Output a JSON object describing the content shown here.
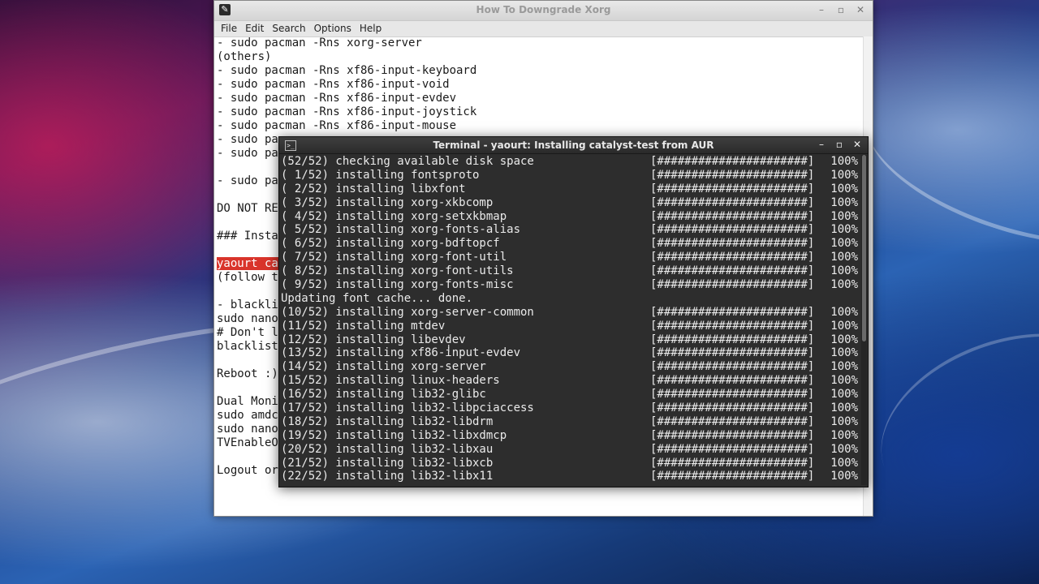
{
  "editor": {
    "title": "How To Downgrade Xorg",
    "menu": [
      "File",
      "Edit",
      "Search",
      "Options",
      "Help"
    ],
    "lines": [
      "- sudo pacman -Rns xorg-server",
      "(others)",
      "- sudo pacman -Rns xf86-input-keyboard",
      "- sudo pacman -Rns xf86-input-void",
      "- sudo pacman -Rns xf86-input-evdev",
      "- sudo pacman -Rns xf86-input-joystick",
      "- sudo pacman -Rns xf86-input-mouse",
      "- sudo pa",
      "- sudo pa",
      "",
      "- sudo pa",
      "",
      "DO NOT RE",
      "",
      "### Insta",
      "",
      "yaourt ca",
      "(follow t",
      "",
      "- blackli",
      "sudo nano",
      "# Don't l",
      "blacklist",
      "",
      "Reboot :)",
      "",
      "Dual Moni",
      "sudo amdc",
      "sudo nano",
      "TVEnableO",
      "",
      "Logout or"
    ]
  },
  "terminal": {
    "title": "Terminal - yaourt: Installing catalyst-test from AUR",
    "bar": "[######################]",
    "lines": [
      {
        "text": "(52/52) checking available disk space",
        "pct": "100%"
      },
      {
        "text": "( 1/52) installing fontsproto",
        "pct": "100%"
      },
      {
        "text": "( 2/52) installing libxfont",
        "pct": "100%"
      },
      {
        "text": "( 3/52) installing xorg-xkbcomp",
        "pct": "100%"
      },
      {
        "text": "( 4/52) installing xorg-setxkbmap",
        "pct": "100%"
      },
      {
        "text": "( 5/52) installing xorg-fonts-alias",
        "pct": "100%"
      },
      {
        "text": "( 6/52) installing xorg-bdftopcf",
        "pct": "100%"
      },
      {
        "text": "( 7/52) installing xorg-font-util",
        "pct": "100%"
      },
      {
        "text": "( 8/52) installing xorg-font-utils",
        "pct": "100%"
      },
      {
        "text": "( 9/52) installing xorg-fonts-misc",
        "pct": "100%"
      },
      {
        "text": "Updating font cache... done.",
        "pct": ""
      },
      {
        "text": "(10/52) installing xorg-server-common",
        "pct": "100%"
      },
      {
        "text": "(11/52) installing mtdev",
        "pct": "100%"
      },
      {
        "text": "(12/52) installing libevdev",
        "pct": "100%"
      },
      {
        "text": "(13/52) installing xf86-input-evdev",
        "pct": "100%"
      },
      {
        "text": "(14/52) installing xorg-server",
        "pct": "100%"
      },
      {
        "text": "(15/52) installing linux-headers",
        "pct": "100%"
      },
      {
        "text": "(16/52) installing lib32-glibc",
        "pct": "100%"
      },
      {
        "text": "(17/52) installing lib32-libpciaccess",
        "pct": "100%"
      },
      {
        "text": "(18/52) installing lib32-libdrm",
        "pct": "100%"
      },
      {
        "text": "(19/52) installing lib32-libxdmcp",
        "pct": "100%"
      },
      {
        "text": "(20/52) installing lib32-libxau",
        "pct": "100%"
      },
      {
        "text": "(21/52) installing lib32-libxcb",
        "pct": "100%"
      },
      {
        "text": "(22/52) installing lib32-libx11",
        "pct": "100%"
      }
    ]
  },
  "colors": {
    "highlight": "#d9342b",
    "terminal_bg": "#2d2d2d",
    "terminal_fg": "#eaeaea"
  }
}
